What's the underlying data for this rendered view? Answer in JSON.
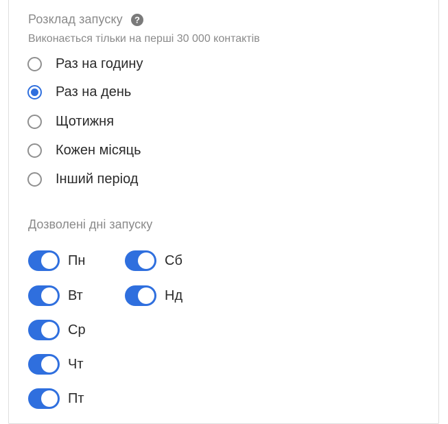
{
  "schedule": {
    "title": "Розклад запуску",
    "subtitle": "Виконається тільки на перші 30 000 контактів",
    "options": [
      {
        "label": "Раз на годину",
        "checked": false
      },
      {
        "label": "Раз на день",
        "checked": true
      },
      {
        "label": "Щотижня",
        "checked": false
      },
      {
        "label": "Кожен місяць",
        "checked": false
      },
      {
        "label": "Інший період",
        "checked": false
      }
    ]
  },
  "days": {
    "title": "Дозволені дні запуску",
    "items": [
      {
        "label": "Пн",
        "enabled": true
      },
      {
        "label": "Вт",
        "enabled": true
      },
      {
        "label": "Ср",
        "enabled": true
      },
      {
        "label": "Чт",
        "enabled": true
      },
      {
        "label": "Пт",
        "enabled": true
      },
      {
        "label": "Сб",
        "enabled": true
      },
      {
        "label": "Нд",
        "enabled": true
      }
    ]
  },
  "colors": {
    "accent": "#2f6fde",
    "muted_text": "#8a8a8a",
    "text": "#2b2b2b"
  },
  "icons": {
    "help": "question-circle-icon"
  }
}
